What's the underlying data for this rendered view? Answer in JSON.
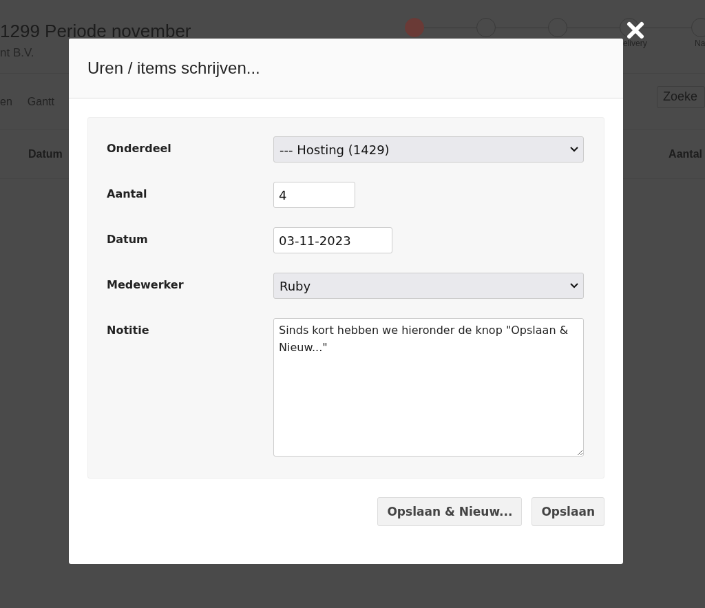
{
  "page": {
    "title": "1299 Periode november",
    "subtitle": "nt B.V.",
    "steps": [
      {
        "active": true
      },
      {
        "active": false
      },
      {
        "active": false
      },
      {
        "active": false,
        "label": "elivery"
      },
      {
        "active": false,
        "label": "Na"
      }
    ],
    "tabs": [
      "en",
      "Gantt"
    ],
    "search": {
      "placeholder": "Zoeke"
    },
    "columns": [
      "Datum",
      "Aantal"
    ]
  },
  "dialog": {
    "title": "Uren / items schrijven...",
    "fields": [
      {
        "kind": "select",
        "label": "Onderdeel",
        "value": "--- Hosting (1429)"
      },
      {
        "kind": "short",
        "label": "Aantal",
        "value": "4"
      },
      {
        "kind": "date",
        "label": "Datum",
        "value": "03-11-2023"
      },
      {
        "kind": "select",
        "label": "Medewerker",
        "value": "Ruby"
      },
      {
        "kind": "textarea",
        "label": "Notitie",
        "value": "Sinds kort hebben we hieronder de knop \"Opslaan & Nieuw...\""
      }
    ],
    "buttons": [
      "Opslaan & Nieuw...",
      "Opslaan"
    ]
  }
}
